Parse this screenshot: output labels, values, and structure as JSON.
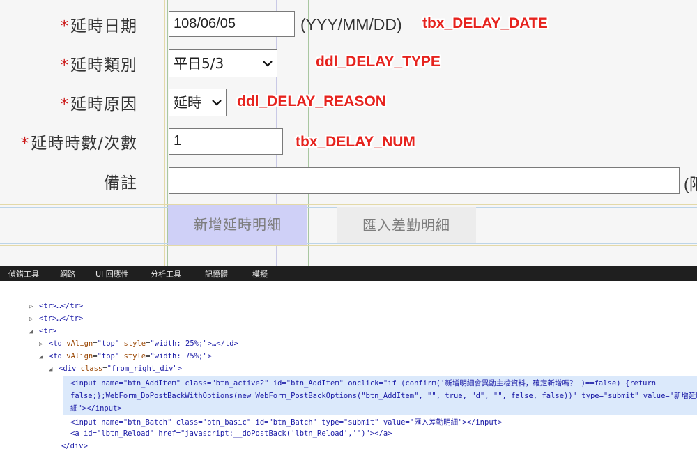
{
  "form": {
    "rows": [
      {
        "required": "*",
        "label": "延時日期"
      },
      {
        "required": "*",
        "label": "延時類別"
      },
      {
        "required": "*",
        "label": "延時原因"
      },
      {
        "required": "*",
        "label": "延時時數/次數"
      },
      {
        "required": "",
        "label": "備註"
      }
    ],
    "delay_date_value": "108/06/05",
    "date_format_hint": "(YYY/MM/DD)",
    "delay_type_value": "平日5/3",
    "delay_reason_value": "延時",
    "delay_num_value": "1",
    "remark_value": "",
    "remark_suffix": "(限"
  },
  "annotations": {
    "date": "tbx_DELAY_DATE",
    "type": "ddl_DELAY_TYPE",
    "reason": "ddl_DELAY_REASON",
    "num": "tbx_DELAY_NUM"
  },
  "buttons": {
    "add": "新增延時明細",
    "batch": "匯入差勤明細"
  },
  "devtools": {
    "tabs": [
      "偵錯工具",
      "網路",
      "UI 回應性",
      "分析工具",
      "記憶體",
      "模擬"
    ],
    "lines": {
      "tr1": "<tr>…</tr>",
      "tr2": "<tr>…</tr>",
      "tr3": "<tr>",
      "td1_open": "<td",
      "td1_attr1_name": "vAlign",
      "td1_attr1_val": "\"top\"",
      "td1_attr2_name": "style",
      "td1_attr2_val": "\"width: 25%;\"",
      "td1_close": ">…</td>",
      "td2_open": "<td",
      "td2_attr1_name": "vAlign",
      "td2_attr1_val": "\"top\"",
      "td2_attr2_name": "style",
      "td2_attr2_val": "\"width: 75%;\"",
      "td2_close": ">",
      "div_open": "<div",
      "div_attr_name": "class",
      "div_attr_val": "\"from_right_div\"",
      "div_close": ">",
      "input1_l1": "<input name=\"btn_AddItem\" class=\"btn_active2\" id=\"btn_AddItem\" onclick=\"if (confirm('新增明細會異動主檔資料，確定新增嗎？')==false) {return",
      "input1_l2": "false;};WebForm_DoPostBackWithOptions(new WebForm_PostBackOptions(\"btn_AddItem\", \"\", true, \"d\", \"\", false, false))\" type=\"submit\" value=\"新增延時明",
      "input1_l3": "細\"></input>",
      "input2": "<input name=\"btn_Batch\" class=\"btn_basic\" id=\"btn_Batch\" type=\"submit\" value=\"匯入差勤明細\"></input>",
      "anchor": "<a id=\"lbtn_Reload\" href=\"javascript:__doPostBack('lbtn_Reload','')\"></a>",
      "div_end": "</div>"
    }
  }
}
